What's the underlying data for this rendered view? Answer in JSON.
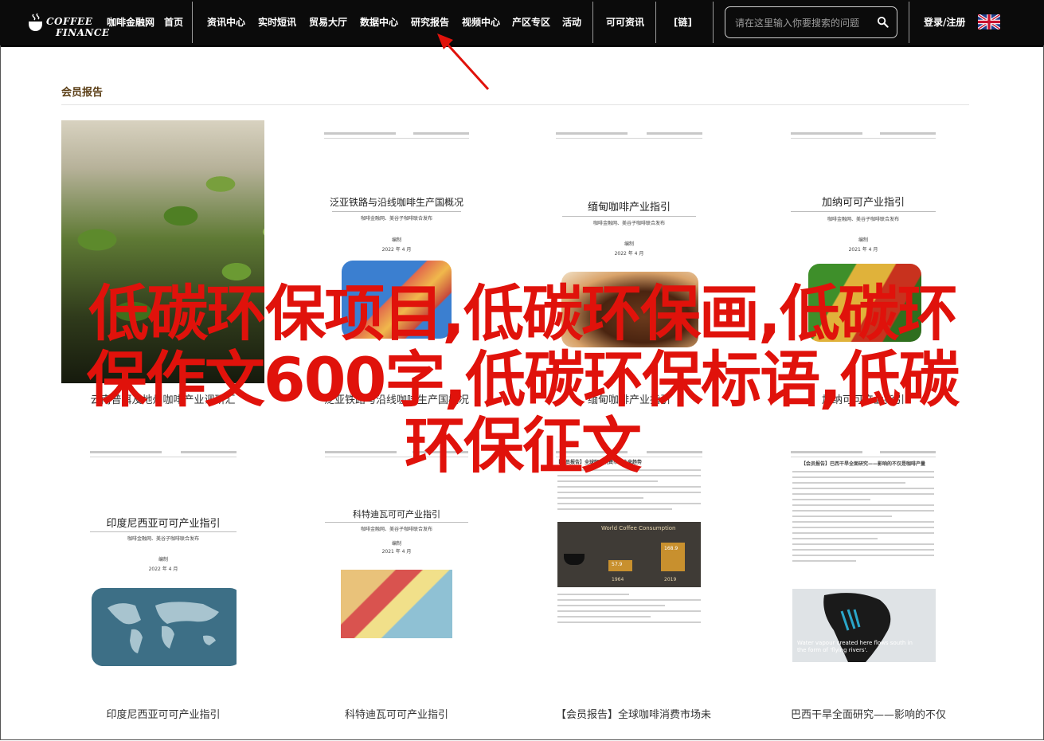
{
  "header": {
    "logo_line1": "COFFEE",
    "logo_line2": "FINANCE",
    "nav": [
      "咖啡金融网",
      "首页",
      "资讯中心",
      "实时短讯",
      "贸易大厅",
      "数据中心",
      "研究报告",
      "视频中心",
      "产区专区",
      "活动",
      "可可资讯",
      "[链]"
    ],
    "search_placeholder": "请在这里输入你要搜索的问题",
    "login": "登录/注册"
  },
  "section_title": "会员报告",
  "overlay_title": "低碳环保项目,低碳环保画,低碳环保作文600字,低碳环保标语,低碳环保征文",
  "cards_row1": [
    {
      "caption": "云南普洱及地州咖啡产业调研汇",
      "doc_title": ""
    },
    {
      "caption": "泛亚铁路与沿线咖啡生产国概况",
      "doc_title": "泛亚铁路与沿线咖啡生产国概况",
      "doc_sub": "咖啡金融网、美谷子咖啡联合发布",
      "doc_label": "编制",
      "doc_date": "2022 年 4 月"
    },
    {
      "caption": "缅甸咖啡产业指引",
      "doc_title": "缅甸咖啡产业指引",
      "doc_sub": "咖啡金融网、美谷子咖啡联合发布",
      "doc_label": "编制",
      "doc_date": "2022 年 4 月"
    },
    {
      "caption": "加纳可可产业指引",
      "doc_title": "加纳可可产业指引",
      "doc_sub": "咖啡金融网、美谷子咖啡联合发布",
      "doc_label": "编制",
      "doc_date": "2021 年 4 月"
    }
  ],
  "cards_row2": [
    {
      "caption": "印度尼西亚可可产业指引",
      "doc_title": "印度尼西亚可可产业指引",
      "doc_sub": "咖啡金融网、美谷子咖啡联合发布",
      "doc_label": "编制",
      "doc_date": "2022 年 4 月"
    },
    {
      "caption": "科特迪瓦可可产业指引",
      "doc_title": "科特迪瓦可可产业指引",
      "doc_sub": "咖啡金融网、美谷子咖啡联合发布",
      "doc_label": "编制",
      "doc_date": "2021 年 4 月"
    },
    {
      "caption": "【会员报告】全球咖啡消费市场未",
      "doc_title": "【会员报告】全球咖啡消费市场未来趋势",
      "chart_title": "World Coffee Consumption",
      "chart_values": [
        "57.9",
        "168.9"
      ],
      "chart_years": [
        "1964",
        "2019"
      ]
    },
    {
      "caption": "巴西干旱全面研究——影响的不仅",
      "doc_title": "【会员报告】巴西干旱全面研究——影响的不仅是咖啡产量",
      "map_text": "Water vapour created here flows south in the form of 'flying rivers'."
    }
  ]
}
